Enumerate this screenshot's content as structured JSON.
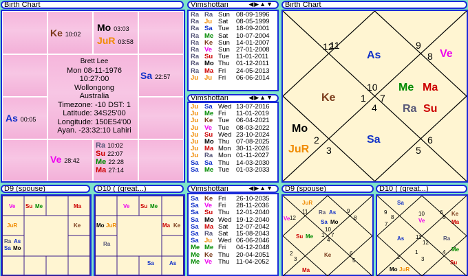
{
  "colors": {
    "Ke": "#7a3a1a",
    "Mo": "#000000",
    "JuR": "#f08a00",
    "Sa": "#1030c8",
    "As": "#1030c8",
    "Ve": "#ee00ee",
    "Ra": "#555577",
    "Su": "#cc0000",
    "Me": "#008a00",
    "Ma": "#cc0000",
    "Ju": "#f08a00"
  },
  "left_chart": {
    "title": "Birth Chart",
    "info": [
      "Brett Lee",
      "Mon 08-11-1976",
      "10:27:00",
      "Wollongong",
      "Australia",
      "Timezone: -10 DST: 1",
      "Latitude: 34S25'00",
      "Longitude: 150E54'00",
      "Ayan. -23:32:10 Lahiri"
    ],
    "ke": {
      "p": "Ke",
      "d": "10:02"
    },
    "mo": {
      "p": "Mo",
      "d": "03:03"
    },
    "jur": {
      "p": "JuR",
      "d": "03:58"
    },
    "sa": {
      "p": "Sa",
      "d": "22:57"
    },
    "as": {
      "p": "As",
      "d": "00:05"
    },
    "ve": {
      "p": "Ve",
      "d": "28:42"
    },
    "ra": {
      "p": "Ra",
      "d": "10:02"
    },
    "su": {
      "p": "Su",
      "d": "22:07"
    },
    "me": {
      "p": "Me",
      "d": "22:28"
    },
    "ma": {
      "p": "Ma",
      "d": "27:14"
    }
  },
  "vim1": {
    "title": "Vimshottari",
    "ctl": "◀▶▲▼",
    "rows": [
      [
        "Ra",
        "Ra",
        "Sun",
        "08-09-1996"
      ],
      [
        "Ra",
        "Ju",
        "Sat",
        "08-05-1999"
      ],
      [
        "Ra",
        "Sa",
        "Tue",
        "18-09-2001"
      ],
      [
        "Ra",
        "Me",
        "Sat",
        "10-07-2004"
      ],
      [
        "Ra",
        "Ke",
        "Sun",
        "14-01-2007"
      ],
      [
        "Ra",
        "Ve",
        "Sun",
        "27-01-2008"
      ],
      [
        "Ra",
        "Su",
        "Tue",
        "11-01-2011"
      ],
      [
        "Ra",
        "Mo",
        "Thu",
        "01-12-2011"
      ],
      [
        "Ra",
        "Ma",
        "Fri",
        "24-05-2013"
      ],
      [
        "Ju",
        "Ju",
        "Fri",
        "06-06-2014"
      ]
    ]
  },
  "vim2": {
    "title": "Vimshottari",
    "ctl": "◀▶▲▼",
    "rows": [
      [
        "Ju",
        "Sa",
        "Wed",
        "13-07-2016"
      ],
      [
        "Ju",
        "Me",
        "Fri",
        "11-01-2019"
      ],
      [
        "Ju",
        "Ke",
        "Tue",
        "06-04-2021"
      ],
      [
        "Ju",
        "Ve",
        "Tue",
        "08-03-2022"
      ],
      [
        "Ju",
        "Su",
        "Wed",
        "23-10-2024"
      ],
      [
        "Ju",
        "Mo",
        "Thu",
        "07-08-2025"
      ],
      [
        "Ju",
        "Ma",
        "Mon",
        "30-11-2026"
      ],
      [
        "Ju",
        "Ra",
        "Mon",
        "01-11-2027"
      ],
      [
        "Sa",
        "Sa",
        "Thu",
        "14-03-2030"
      ],
      [
        "Sa",
        "Me",
        "Tue",
        "01-03-2033"
      ]
    ]
  },
  "vim3": {
    "title": "Vimshottari",
    "ctl": "◀▶▲▼",
    "rows": [
      [
        "Sa",
        "Ke",
        "Fri",
        "26-10-2035"
      ],
      [
        "Sa",
        "Ve",
        "Fri",
        "28-11-2036"
      ],
      [
        "Sa",
        "Su",
        "Thu",
        "12-01-2040"
      ],
      [
        "Sa",
        "Mo",
        "Wed",
        "19-12-2040"
      ],
      [
        "Sa",
        "Ma",
        "Sat",
        "12-07-2042"
      ],
      [
        "Sa",
        "Ra",
        "Sat",
        "15-08-2043"
      ],
      [
        "Sa",
        "Ju",
        "Wed",
        "06-06-2046"
      ],
      [
        "Me",
        "Me",
        "Fri",
        "04-12-2048"
      ],
      [
        "Me",
        "Ke",
        "Thu",
        "20-04-2051"
      ],
      [
        "Me",
        "Ve",
        "Thu",
        "11-04-2052"
      ]
    ]
  },
  "right_chart": {
    "title": "Birth Chart",
    "h12": "12",
    "h11": "11",
    "h9": "9",
    "h8": "8",
    "h10": "10",
    "h1": "1",
    "h7": "7",
    "h4": "4",
    "h2": "2",
    "h3": "3",
    "h6": "6",
    "h5": "5",
    "as1": "As",
    "ve": "Ve",
    "ke": "Ke",
    "me": "Me",
    "ma": "Ma",
    "ra": "Ra",
    "su": "Su",
    "mo": "Mo",
    "jur": "JuR",
    "sa": "Sa"
  },
  "d9_south": {
    "title": "D9  (spouse)",
    "ve": "Ve",
    "su": "Su",
    "me": "Me",
    "ma": "Ma",
    "jur": "JuR",
    "ke": "Ke",
    "ra": "Ra",
    "as": "As",
    "sa": "Sa",
    "mo": "Mo"
  },
  "d10_south": {
    "title": "D10 ( (great...)",
    "ve": "Ve",
    "su": "Su",
    "me": "Me",
    "mo": "Mo",
    "jur": "JuR",
    "ma": "Ma",
    "ke": "Ke",
    "ra": "Ra",
    "sa": "Sa",
    "as": "As"
  },
  "d9_north": {
    "title": "D9  (spouse)",
    "jur": "JuR",
    "ve": "Ve",
    "ra": "Ra",
    "as": "As",
    "sa": "Sa",
    "mo": "Mo",
    "su": "Su",
    "me": "Me",
    "ke": "Ke",
    "ma": "Ma",
    "n12": "12",
    "n11": "11",
    "n10": "10",
    "n9": "9",
    "n1": "1",
    "n8": "8",
    "n7": "7",
    "n4": "4",
    "n2": "2",
    "n3": "3",
    "n5": "5",
    "n6": "6"
  },
  "d10_north": {
    "title": "D10 ( (great...)",
    "sa": "Sa",
    "ve": "Ve",
    "ke": "Ke",
    "ma": "Ma",
    "as": "As",
    "ra": "Ra",
    "me": "Me",
    "mo": "Mo",
    "jur": "JuR",
    "su": "Su",
    "n9": "9",
    "n8": "8",
    "n10": "10",
    "n7": "7",
    "n6": "6",
    "n5": "5",
    "n11": "11",
    "n12": "12",
    "n1": "1",
    "n4": "4",
    "n2": "2",
    "n3": "3"
  }
}
